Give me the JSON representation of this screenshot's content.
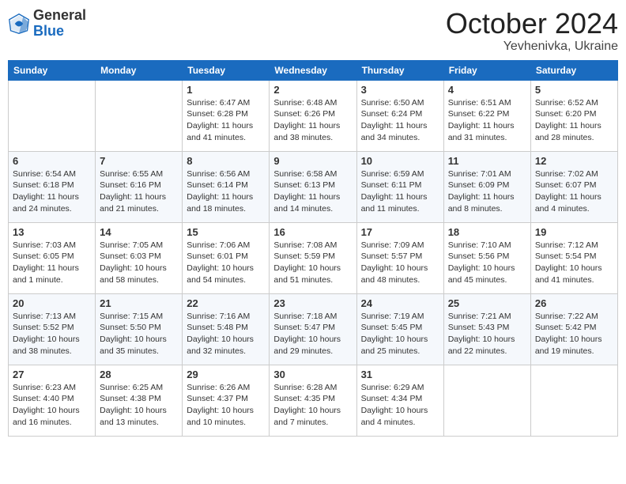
{
  "header": {
    "logo_general": "General",
    "logo_blue": "Blue",
    "month": "October 2024",
    "location": "Yevhenivka, Ukraine"
  },
  "weekdays": [
    "Sunday",
    "Monday",
    "Tuesday",
    "Wednesday",
    "Thursday",
    "Friday",
    "Saturday"
  ],
  "weeks": [
    [
      {
        "day": "",
        "info": ""
      },
      {
        "day": "",
        "info": ""
      },
      {
        "day": "1",
        "info": "Sunrise: 6:47 AM\nSunset: 6:28 PM\nDaylight: 11 hours\nand 41 minutes."
      },
      {
        "day": "2",
        "info": "Sunrise: 6:48 AM\nSunset: 6:26 PM\nDaylight: 11 hours\nand 38 minutes."
      },
      {
        "day": "3",
        "info": "Sunrise: 6:50 AM\nSunset: 6:24 PM\nDaylight: 11 hours\nand 34 minutes."
      },
      {
        "day": "4",
        "info": "Sunrise: 6:51 AM\nSunset: 6:22 PM\nDaylight: 11 hours\nand 31 minutes."
      },
      {
        "day": "5",
        "info": "Sunrise: 6:52 AM\nSunset: 6:20 PM\nDaylight: 11 hours\nand 28 minutes."
      }
    ],
    [
      {
        "day": "6",
        "info": "Sunrise: 6:54 AM\nSunset: 6:18 PM\nDaylight: 11 hours\nand 24 minutes."
      },
      {
        "day": "7",
        "info": "Sunrise: 6:55 AM\nSunset: 6:16 PM\nDaylight: 11 hours\nand 21 minutes."
      },
      {
        "day": "8",
        "info": "Sunrise: 6:56 AM\nSunset: 6:14 PM\nDaylight: 11 hours\nand 18 minutes."
      },
      {
        "day": "9",
        "info": "Sunrise: 6:58 AM\nSunset: 6:13 PM\nDaylight: 11 hours\nand 14 minutes."
      },
      {
        "day": "10",
        "info": "Sunrise: 6:59 AM\nSunset: 6:11 PM\nDaylight: 11 hours\nand 11 minutes."
      },
      {
        "day": "11",
        "info": "Sunrise: 7:01 AM\nSunset: 6:09 PM\nDaylight: 11 hours\nand 8 minutes."
      },
      {
        "day": "12",
        "info": "Sunrise: 7:02 AM\nSunset: 6:07 PM\nDaylight: 11 hours\nand 4 minutes."
      }
    ],
    [
      {
        "day": "13",
        "info": "Sunrise: 7:03 AM\nSunset: 6:05 PM\nDaylight: 11 hours\nand 1 minute."
      },
      {
        "day": "14",
        "info": "Sunrise: 7:05 AM\nSunset: 6:03 PM\nDaylight: 10 hours\nand 58 minutes."
      },
      {
        "day": "15",
        "info": "Sunrise: 7:06 AM\nSunset: 6:01 PM\nDaylight: 10 hours\nand 54 minutes."
      },
      {
        "day": "16",
        "info": "Sunrise: 7:08 AM\nSunset: 5:59 PM\nDaylight: 10 hours\nand 51 minutes."
      },
      {
        "day": "17",
        "info": "Sunrise: 7:09 AM\nSunset: 5:57 PM\nDaylight: 10 hours\nand 48 minutes."
      },
      {
        "day": "18",
        "info": "Sunrise: 7:10 AM\nSunset: 5:56 PM\nDaylight: 10 hours\nand 45 minutes."
      },
      {
        "day": "19",
        "info": "Sunrise: 7:12 AM\nSunset: 5:54 PM\nDaylight: 10 hours\nand 41 minutes."
      }
    ],
    [
      {
        "day": "20",
        "info": "Sunrise: 7:13 AM\nSunset: 5:52 PM\nDaylight: 10 hours\nand 38 minutes."
      },
      {
        "day": "21",
        "info": "Sunrise: 7:15 AM\nSunset: 5:50 PM\nDaylight: 10 hours\nand 35 minutes."
      },
      {
        "day": "22",
        "info": "Sunrise: 7:16 AM\nSunset: 5:48 PM\nDaylight: 10 hours\nand 32 minutes."
      },
      {
        "day": "23",
        "info": "Sunrise: 7:18 AM\nSunset: 5:47 PM\nDaylight: 10 hours\nand 29 minutes."
      },
      {
        "day": "24",
        "info": "Sunrise: 7:19 AM\nSunset: 5:45 PM\nDaylight: 10 hours\nand 25 minutes."
      },
      {
        "day": "25",
        "info": "Sunrise: 7:21 AM\nSunset: 5:43 PM\nDaylight: 10 hours\nand 22 minutes."
      },
      {
        "day": "26",
        "info": "Sunrise: 7:22 AM\nSunset: 5:42 PM\nDaylight: 10 hours\nand 19 minutes."
      }
    ],
    [
      {
        "day": "27",
        "info": "Sunrise: 6:23 AM\nSunset: 4:40 PM\nDaylight: 10 hours\nand 16 minutes."
      },
      {
        "day": "28",
        "info": "Sunrise: 6:25 AM\nSunset: 4:38 PM\nDaylight: 10 hours\nand 13 minutes."
      },
      {
        "day": "29",
        "info": "Sunrise: 6:26 AM\nSunset: 4:37 PM\nDaylight: 10 hours\nand 10 minutes."
      },
      {
        "day": "30",
        "info": "Sunrise: 6:28 AM\nSunset: 4:35 PM\nDaylight: 10 hours\nand 7 minutes."
      },
      {
        "day": "31",
        "info": "Sunrise: 6:29 AM\nSunset: 4:34 PM\nDaylight: 10 hours\nand 4 minutes."
      },
      {
        "day": "",
        "info": ""
      },
      {
        "day": "",
        "info": ""
      }
    ]
  ]
}
